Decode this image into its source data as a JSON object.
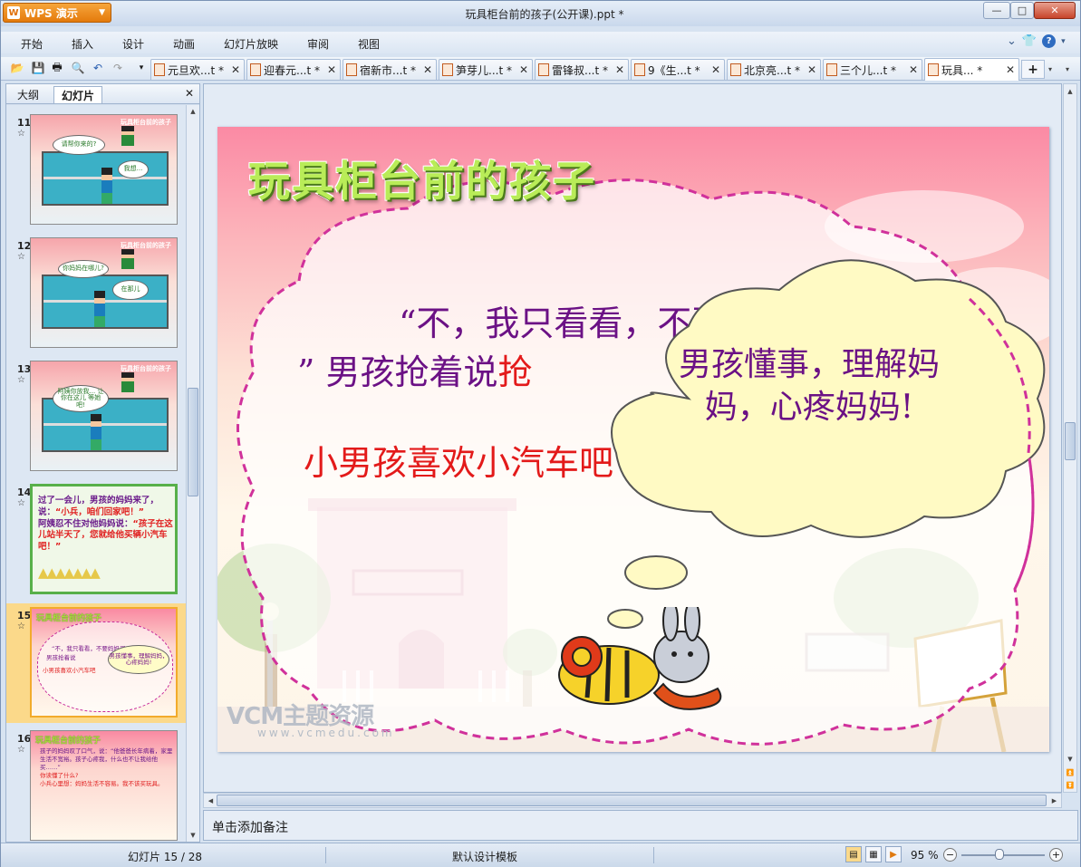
{
  "app": {
    "button_label": "WPS 演示",
    "window_title": "玩具柜台前的孩子(公开课).ppt *"
  },
  "menu": [
    "开始",
    "插入",
    "设计",
    "动画",
    "幻灯片放映",
    "审阅",
    "视图"
  ],
  "doc_tabs": [
    {
      "label": "元旦欢...t *"
    },
    {
      "label": "迎春元...t *"
    },
    {
      "label": "宿新市...t *"
    },
    {
      "label": "笋芽儿...t *"
    },
    {
      "label": "雷锋叔...t *"
    },
    {
      "label": "9《生...t *"
    },
    {
      "label": "北京亮...t *"
    },
    {
      "label": "三个儿...t *"
    },
    {
      "label": "玩具... *"
    }
  ],
  "left_pane": {
    "tabs": [
      "大纲",
      "幻灯片"
    ],
    "thumbnails": [
      {
        "num": "11",
        "star": "☆",
        "bubble1": "请帮你来的?",
        "bubble2": "我想...",
        "title": "玩具柜台前的孩子"
      },
      {
        "num": "12",
        "star": "☆",
        "bubble1": "你妈妈在哪儿?",
        "bubble2": "在那儿",
        "title": "玩具柜台前的孩子"
      },
      {
        "num": "13",
        "star": "☆",
        "bubble1": "阿姨你放我... 让你在这儿 等她 吧!",
        "bubble2": "",
        "title": "玩具柜台前的孩子"
      },
      {
        "num": "14",
        "star": "☆",
        "text_a": "过了一会儿，男孩的妈妈来了，说：",
        "text_b": "“小兵，咱们回家吧！”",
        "text_c": "阿姨忍不住对他妈妈说：",
        "text_d": "“孩子在这儿站半天了，您就给他买辆小汽车吧！”"
      },
      {
        "num": "15",
        "star": "☆",
        "title": "玩具柜台前的孩子",
        "line1": "“不，我只看看，不要妈妈买”",
        "line2": "男孩抢着说",
        "cloud": "男孩懂事，理解妈妈，心疼妈妈!",
        "red": "小男孩喜欢小汽车吧"
      },
      {
        "num": "16",
        "star": "☆",
        "title": "玩具柜台前的孩子",
        "text_a": "孩子的妈妈叹了口气，说：“他爸爸长年病着，家里生活不宽裕。孩子心疼我，什么也不让我给他买……”",
        "text_b": "你读懂了什么?",
        "text_c": "小兵心里想：妈妈生活不容易。我不该买玩具。"
      }
    ]
  },
  "slide": {
    "title": "玩具柜台前的孩子",
    "quote_line1": "“不，我只看看，不要妈妈买",
    "quote_line2_open": "”  男孩抢着说",
    "quote_line2_red": "抢",
    "red_line": "小男孩喜欢小汽车吧",
    "thought": "男孩懂事，理解妈妈，心疼妈妈!",
    "watermark_logo": "VCM主题资源",
    "watermark_url": "www.vcmedu.com"
  },
  "notes": {
    "placeholder": "单击添加备注"
  },
  "status": {
    "slide_pos": "幻灯片 15 / 28",
    "template": "默认设计模板",
    "zoom": "95 %"
  },
  "colors": {
    "accent_orange": "#e47a0c",
    "slide_purple": "#6b1185",
    "slide_red": "#e31a1a",
    "title_green": "#b9ec58",
    "cloud_border": "#d0319b",
    "thought_fill": "#fffac4"
  }
}
